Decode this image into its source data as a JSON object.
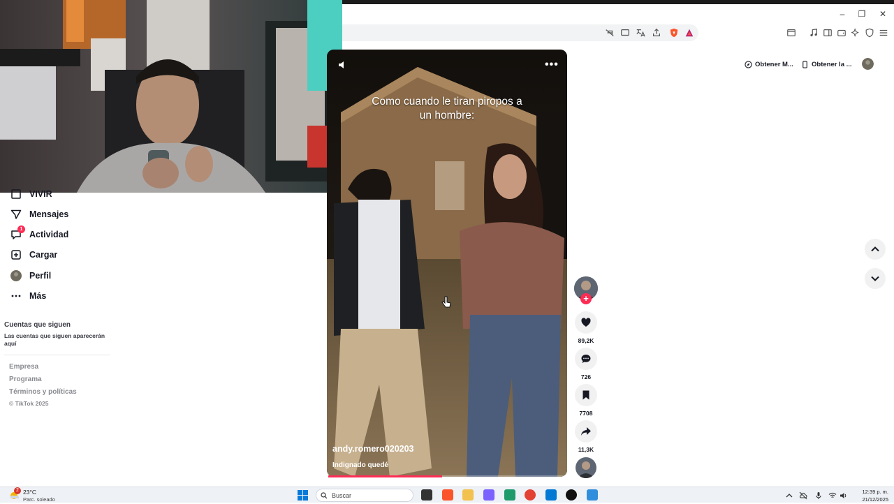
{
  "sidebar": {
    "items": [
      {
        "label": "VIVIR",
        "icon": "live-icon"
      },
      {
        "label": "Mensajes",
        "icon": "messages-icon"
      },
      {
        "label": "Actividad",
        "icon": "activity-icon",
        "badge": "1"
      },
      {
        "label": "Cargar",
        "icon": "upload-icon"
      },
      {
        "label": "Perfil",
        "icon": "profile-avatar"
      },
      {
        "label": "Más",
        "icon": "more-icon"
      }
    ],
    "following_title": "Cuentas que siguen",
    "following_desc": "Las cuentas que siguen aparecerán aquí",
    "footer_links": [
      "Empresa",
      "Programa",
      "Términos y políticas"
    ],
    "copyright": "© TikTok 2025"
  },
  "topbar": {
    "pill_1": "Obtener M...",
    "pill_2": "Obtener la ..."
  },
  "video": {
    "caption": "Como cuando le tiran piropos a un hombre:",
    "author": "andy.romero020203",
    "description": "Indignado quedé",
    "progress": 0.48
  },
  "actions": {
    "likes": "89,2K",
    "comments": "726",
    "saves": "7708",
    "shares": "11,3K"
  },
  "taskbar": {
    "weather_badge": "2",
    "temperature": "23°C",
    "weather_desc": "Parc. soleado",
    "search_placeholder": "Buscar",
    "time": "12:39 p. m.",
    "date": "21/12/2025"
  },
  "colors": {
    "accent": "#fe2c55",
    "text": "#161823",
    "muted": "#8a8b91"
  }
}
